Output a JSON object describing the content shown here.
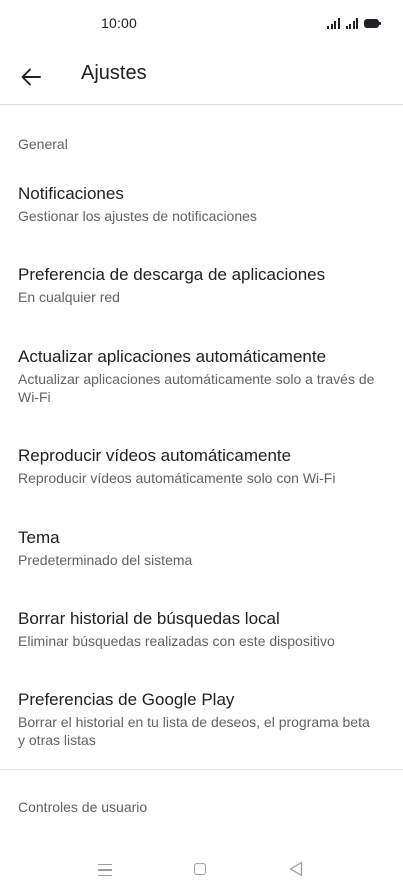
{
  "status_bar": {
    "time": "10:00"
  },
  "app_bar": {
    "title": "Ajustes",
    "back_icon": "arrow-left-icon"
  },
  "sections": {
    "general": {
      "header": "General",
      "items": [
        {
          "title": "Notificaciones",
          "subtitle": "Gestionar los ajustes de notificaciones"
        },
        {
          "title": "Preferencia de descarga de aplicaciones",
          "subtitle": "En cualquier red"
        },
        {
          "title": "Actualizar aplicaciones automáticamente",
          "subtitle": "Actualizar aplicaciones automáticamente solo a través de Wi-Fi"
        },
        {
          "title": "Reproducir vídeos automáticamente",
          "subtitle": "Reproducir vídeos automáticamente solo con Wi-Fi"
        },
        {
          "title": "Tema",
          "subtitle": "Predeterminado del sistema"
        },
        {
          "title": "Borrar historial de búsquedas local",
          "subtitle": "Eliminar búsquedas realizadas con este dispositivo"
        },
        {
          "title": "Preferencias de Google Play",
          "subtitle": "Borrar el historial en tu lista de deseos, el programa beta y otras listas"
        }
      ]
    },
    "user_controls": {
      "header": "Controles de usuario"
    }
  },
  "nav_bar": {
    "icons": [
      "menu-icon",
      "home-square-icon",
      "back-triangle-icon"
    ]
  },
  "colors": {
    "text_primary": "#202124",
    "text_secondary": "#5f6368",
    "divider": "#e0e0e0",
    "nav_icons": "#9e9e9e"
  }
}
